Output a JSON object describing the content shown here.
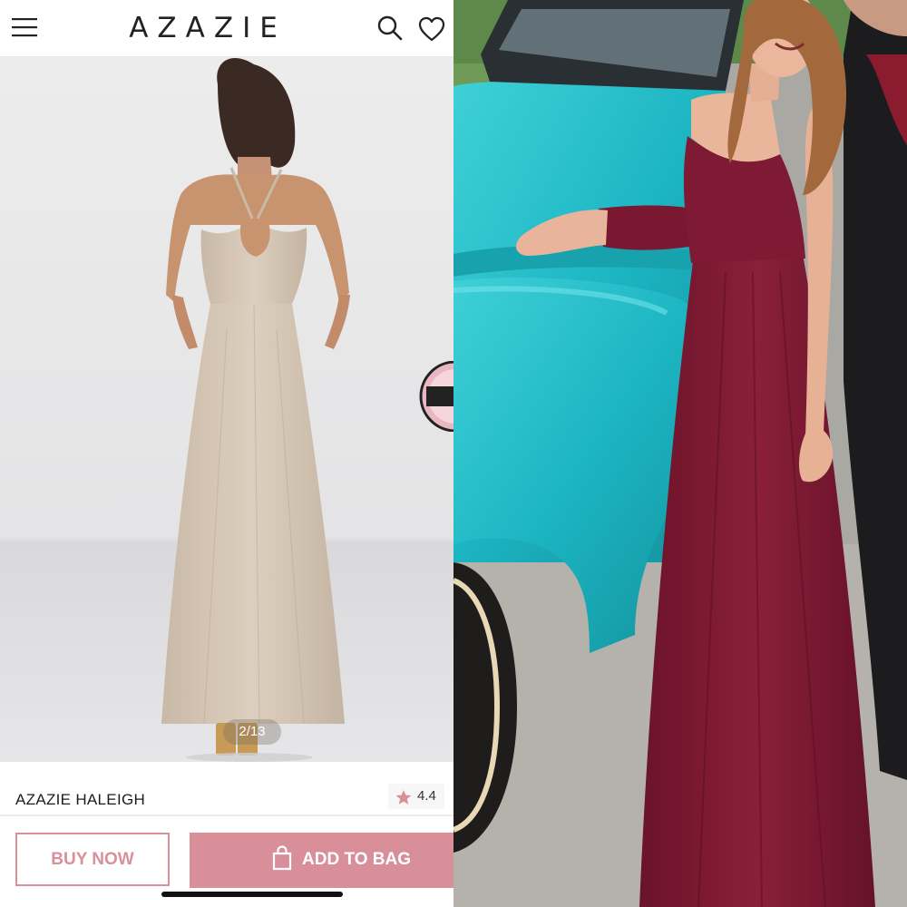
{
  "header": {
    "brand": "AZAZIE",
    "icons": [
      "hamburger-menu-icon",
      "search-icon",
      "heart-icon"
    ]
  },
  "gallery": {
    "counter": "2/13"
  },
  "product": {
    "name": "AZAZIE HALEIGH",
    "rating": "4.4"
  },
  "actions": {
    "buy_now": "BUY NOW",
    "add_to_bag": "ADD TO BAG"
  },
  "colors": {
    "accent": "#d98f9a",
    "dress_champagne": "#d9cab8",
    "dress_burgundy": "#7a1a33",
    "truck_teal": "#1fb8c4"
  }
}
